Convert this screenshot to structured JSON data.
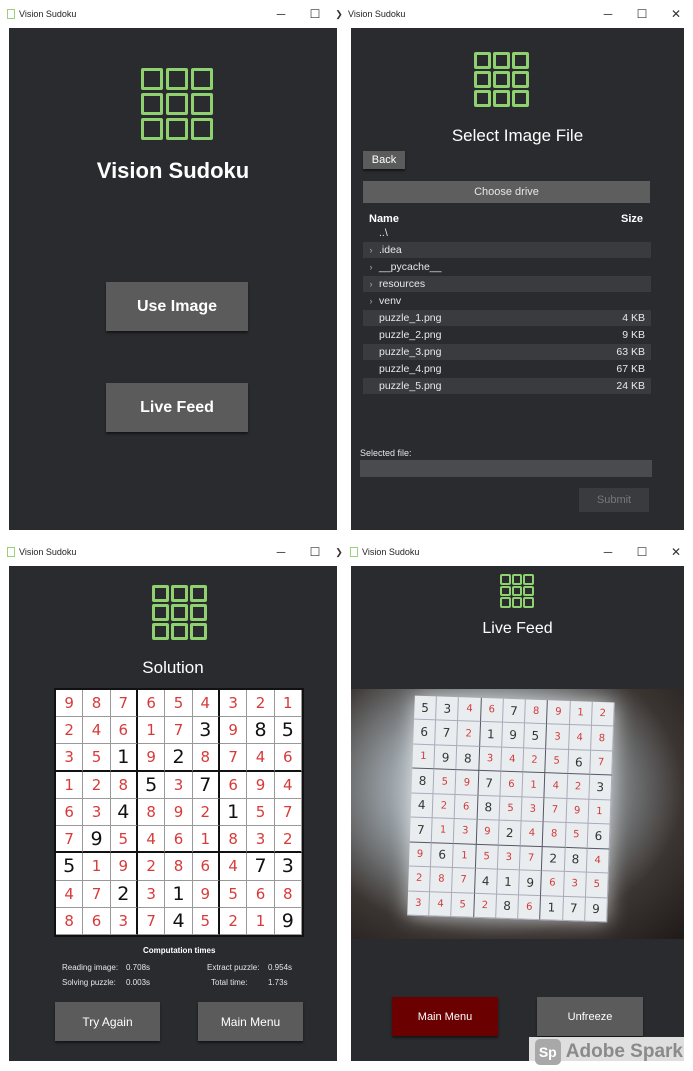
{
  "app_title": "Vision Sudoku",
  "controls": {
    "minimize": "─",
    "maximize": "☐",
    "close": "✕",
    "arrow": "❯"
  },
  "accent": "#8fd16f",
  "main_menu": {
    "title": "Vision Sudoku",
    "use_image": "Use Image",
    "live_feed": "Live Feed"
  },
  "select_file": {
    "title": "Select Image File",
    "back": "Back",
    "choose_drive": "Choose drive",
    "col_name": "Name",
    "col_size": "Size",
    "rows": [
      {
        "name": "..\\",
        "size": "",
        "chevron": ""
      },
      {
        "name": ".idea",
        "size": "",
        "chevron": "›"
      },
      {
        "name": "__pycache__",
        "size": "",
        "chevron": "›"
      },
      {
        "name": "resources",
        "size": "",
        "chevron": "›"
      },
      {
        "name": "venv",
        "size": "",
        "chevron": "›"
      },
      {
        "name": "puzzle_1.png",
        "size": "4 KB",
        "chevron": ""
      },
      {
        "name": "puzzle_2.png",
        "size": "9 KB",
        "chevron": ""
      },
      {
        "name": "puzzle_3.png",
        "size": "63 KB",
        "chevron": ""
      },
      {
        "name": "puzzle_4.png",
        "size": "67 KB",
        "chevron": ""
      },
      {
        "name": "puzzle_5.png",
        "size": "24 KB",
        "chevron": ""
      }
    ],
    "selected_label": "Selected file:",
    "selected_value": "",
    "submit": "Submit"
  },
  "solution": {
    "title": "Solution",
    "grid": [
      [
        9,
        8,
        7,
        6,
        5,
        4,
        3,
        2,
        1
      ],
      [
        2,
        4,
        6,
        1,
        7,
        3,
        9,
        8,
        5
      ],
      [
        3,
        5,
        1,
        9,
        2,
        8,
        7,
        4,
        6
      ],
      [
        1,
        2,
        8,
        5,
        3,
        7,
        6,
        9,
        4
      ],
      [
        6,
        3,
        4,
        8,
        9,
        2,
        1,
        5,
        7
      ],
      [
        7,
        9,
        5,
        4,
        6,
        1,
        8,
        3,
        2
      ],
      [
        5,
        1,
        9,
        2,
        8,
        6,
        4,
        7,
        3
      ],
      [
        4,
        7,
        2,
        3,
        1,
        9,
        5,
        6,
        8
      ],
      [
        8,
        6,
        3,
        7,
        4,
        5,
        2,
        1,
        9
      ]
    ],
    "givens": [
      [
        0,
        0,
        0,
        0,
        0,
        0,
        0,
        0,
        0
      ],
      [
        0,
        0,
        0,
        0,
        0,
        1,
        0,
        1,
        1
      ],
      [
        0,
        0,
        1,
        0,
        1,
        0,
        0,
        0,
        0
      ],
      [
        0,
        0,
        0,
        1,
        0,
        1,
        0,
        0,
        0
      ],
      [
        0,
        0,
        1,
        0,
        0,
        0,
        1,
        0,
        0
      ],
      [
        0,
        1,
        0,
        0,
        0,
        0,
        0,
        0,
        0
      ],
      [
        1,
        0,
        0,
        0,
        0,
        0,
        0,
        1,
        1
      ],
      [
        0,
        0,
        1,
        0,
        1,
        0,
        0,
        0,
        0
      ],
      [
        0,
        0,
        0,
        0,
        1,
        0,
        0,
        0,
        1
      ]
    ],
    "comp_title": "Computation times",
    "reading_label": "Reading image:",
    "reading_value": "0.708s",
    "extract_label": "Extract puzzle:",
    "extract_value": "0.954s",
    "solving_label": "Solving puzzle:",
    "solving_value": "0.003s",
    "total_label": "Total time:",
    "total_value": "1.73s",
    "try_again": "Try Again",
    "main_menu": "Main Menu"
  },
  "live": {
    "title": "Live Feed",
    "grid": [
      [
        "5",
        "3",
        "4",
        "6",
        "7",
        "8",
        "9",
        "1",
        "2"
      ],
      [
        "6",
        "7",
        "2",
        "1",
        "9",
        "5",
        "3",
        "4",
        "8"
      ],
      [
        "1",
        "9",
        "8",
        "3",
        "4",
        "2",
        "5",
        "6",
        "7"
      ],
      [
        "8",
        "5",
        "9",
        "7",
        "6",
        "1",
        "4",
        "2",
        "3"
      ],
      [
        "4",
        "2",
        "6",
        "8",
        "5",
        "3",
        "7",
        "9",
        "1"
      ],
      [
        "7",
        "1",
        "3",
        "9",
        "2",
        "4",
        "8",
        "5",
        "6"
      ],
      [
        "9",
        "6",
        "1",
        "5",
        "3",
        "7",
        "2",
        "8",
        "4"
      ],
      [
        "2",
        "8",
        "7",
        "4",
        "1",
        "9",
        "6",
        "3",
        "5"
      ],
      [
        "3",
        "4",
        "5",
        "2",
        "8",
        "6",
        "1",
        "7",
        "9"
      ]
    ],
    "printed": [
      [
        1,
        1,
        0,
        0,
        1,
        0,
        0,
        0,
        0
      ],
      [
        1,
        1,
        0,
        1,
        1,
        1,
        0,
        0,
        0
      ],
      [
        0,
        1,
        1,
        0,
        0,
        0,
        0,
        1,
        0
      ],
      [
        1,
        0,
        0,
        1,
        0,
        0,
        0,
        0,
        1
      ],
      [
        1,
        0,
        0,
        1,
        0,
        0,
        0,
        0,
        0
      ],
      [
        1,
        0,
        0,
        0,
        1,
        0,
        0,
        0,
        1
      ],
      [
        0,
        1,
        0,
        0,
        0,
        0,
        1,
        1,
        0
      ],
      [
        0,
        0,
        0,
        1,
        1,
        1,
        0,
        0,
        0
      ],
      [
        0,
        0,
        0,
        0,
        1,
        0,
        1,
        1,
        1
      ]
    ],
    "main_menu": "Main Menu",
    "main_menu_color": "#6b0000",
    "unfreeze": "Unfreeze"
  },
  "watermark": {
    "badge": "Sp",
    "text": "Adobe Spark"
  }
}
